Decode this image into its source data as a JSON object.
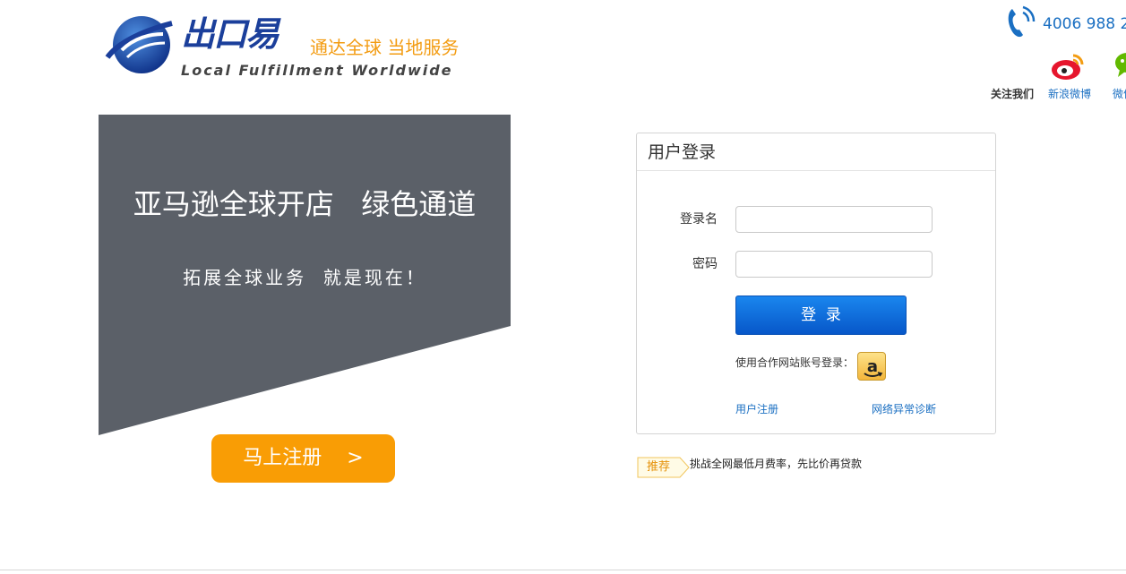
{
  "header": {
    "brand_name": "出口易",
    "slogan": "通达全球 当地服务",
    "tagline": "Local  Fulfillment  Worldwide",
    "phone": "4006 988 2",
    "follow_label": "关注我们",
    "weibo_label": "新浪微博",
    "wechat_label": "微信"
  },
  "banner": {
    "headline": "亚马逊全球开店   绿色通道",
    "subline": "拓展全球业务  就是现在！",
    "register_button": "马上注册    >"
  },
  "login": {
    "title": "用户登录",
    "username_label": "登录名",
    "password_label": "密码",
    "username_value": "",
    "password_value": "",
    "submit_label": "登  录",
    "partner_label": "使用合作网站账号登录：",
    "register_link": "用户注册",
    "diagnose_link": "网络异常诊断"
  },
  "recommend": {
    "badge": "推荐",
    "text": "挑战全网最低月费率，先比价再贷款"
  },
  "colors": {
    "brand_blue": "#1b3f9b",
    "accent_orange": "#f99d05",
    "banner_gray": "#5b6068",
    "link_blue": "#1a6fc2",
    "login_button_blue": "#0a6ad8"
  }
}
